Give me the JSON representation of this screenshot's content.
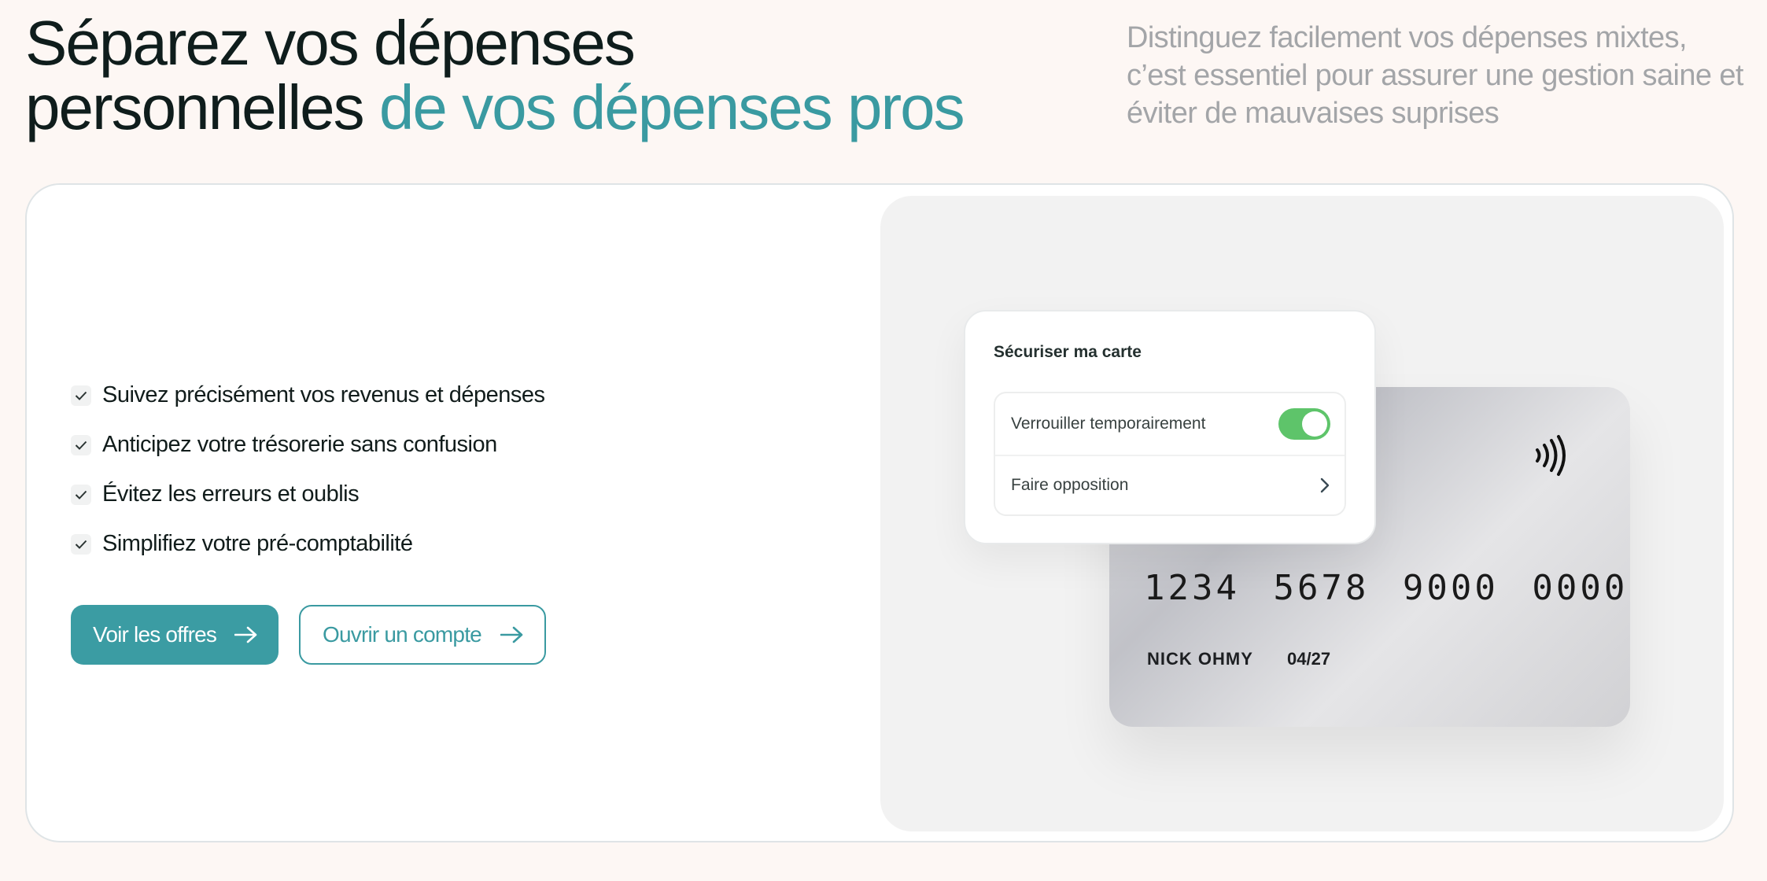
{
  "hero": {
    "title_part1": "Séparez vos dépenses",
    "title_part2": "personnelles ",
    "title_accent": "de vos dépenses pros",
    "subtitle": "Distinguez facilement vos dépenses mixtes, c’est essentiel pour assurer une gestion saine et éviter de mauvaises suprises"
  },
  "features": [
    {
      "label": "Suivez précisément vos revenus et dépenses",
      "icon": "check-icon"
    },
    {
      "label": "Anticipez votre trésorerie sans confusion",
      "icon": "check-icon"
    },
    {
      "label": "Évitez les erreurs et oublis",
      "icon": "check-icon"
    },
    {
      "label": "Simplifiez votre pré-comptabilité",
      "icon": "check-icon"
    }
  ],
  "buttons": {
    "primary_label": "Voir les offres",
    "secondary_label": "Ouvrir un compte",
    "icon": "arrow-right-icon"
  },
  "card": {
    "number": "1234 5678 9000 0000",
    "holder": "NICK OHMY",
    "expiry": "04/27",
    "icon": "contactless-icon"
  },
  "security": {
    "title": "Sécuriser ma carte",
    "lock_label": "Verrouiller temporairement",
    "lock_enabled": true,
    "oppose_label": "Faire opposition",
    "oppose_icon": "chevron-right-icon"
  },
  "colors": {
    "accent": "#3a9aa1",
    "background": "#fdf7f4",
    "toggle_on": "#5ec46a",
    "subtitle": "#a3a5a8"
  }
}
